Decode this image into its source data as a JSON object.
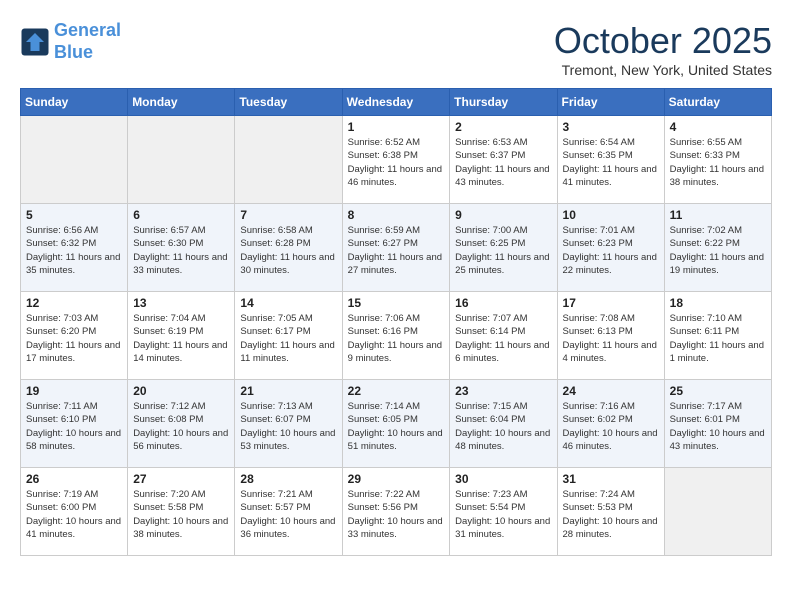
{
  "header": {
    "logo_line1": "General",
    "logo_line2": "Blue",
    "month_title": "October 2025",
    "location": "Tremont, New York, United States"
  },
  "days_of_week": [
    "Sunday",
    "Monday",
    "Tuesday",
    "Wednesday",
    "Thursday",
    "Friday",
    "Saturday"
  ],
  "weeks": [
    [
      {
        "day": "",
        "info": ""
      },
      {
        "day": "",
        "info": ""
      },
      {
        "day": "",
        "info": ""
      },
      {
        "day": "1",
        "info": "Sunrise: 6:52 AM\nSunset: 6:38 PM\nDaylight: 11 hours and 46 minutes."
      },
      {
        "day": "2",
        "info": "Sunrise: 6:53 AM\nSunset: 6:37 PM\nDaylight: 11 hours and 43 minutes."
      },
      {
        "day": "3",
        "info": "Sunrise: 6:54 AM\nSunset: 6:35 PM\nDaylight: 11 hours and 41 minutes."
      },
      {
        "day": "4",
        "info": "Sunrise: 6:55 AM\nSunset: 6:33 PM\nDaylight: 11 hours and 38 minutes."
      }
    ],
    [
      {
        "day": "5",
        "info": "Sunrise: 6:56 AM\nSunset: 6:32 PM\nDaylight: 11 hours and 35 minutes."
      },
      {
        "day": "6",
        "info": "Sunrise: 6:57 AM\nSunset: 6:30 PM\nDaylight: 11 hours and 33 minutes."
      },
      {
        "day": "7",
        "info": "Sunrise: 6:58 AM\nSunset: 6:28 PM\nDaylight: 11 hours and 30 minutes."
      },
      {
        "day": "8",
        "info": "Sunrise: 6:59 AM\nSunset: 6:27 PM\nDaylight: 11 hours and 27 minutes."
      },
      {
        "day": "9",
        "info": "Sunrise: 7:00 AM\nSunset: 6:25 PM\nDaylight: 11 hours and 25 minutes."
      },
      {
        "day": "10",
        "info": "Sunrise: 7:01 AM\nSunset: 6:23 PM\nDaylight: 11 hours and 22 minutes."
      },
      {
        "day": "11",
        "info": "Sunrise: 7:02 AM\nSunset: 6:22 PM\nDaylight: 11 hours and 19 minutes."
      }
    ],
    [
      {
        "day": "12",
        "info": "Sunrise: 7:03 AM\nSunset: 6:20 PM\nDaylight: 11 hours and 17 minutes."
      },
      {
        "day": "13",
        "info": "Sunrise: 7:04 AM\nSunset: 6:19 PM\nDaylight: 11 hours and 14 minutes."
      },
      {
        "day": "14",
        "info": "Sunrise: 7:05 AM\nSunset: 6:17 PM\nDaylight: 11 hours and 11 minutes."
      },
      {
        "day": "15",
        "info": "Sunrise: 7:06 AM\nSunset: 6:16 PM\nDaylight: 11 hours and 9 minutes."
      },
      {
        "day": "16",
        "info": "Sunrise: 7:07 AM\nSunset: 6:14 PM\nDaylight: 11 hours and 6 minutes."
      },
      {
        "day": "17",
        "info": "Sunrise: 7:08 AM\nSunset: 6:13 PM\nDaylight: 11 hours and 4 minutes."
      },
      {
        "day": "18",
        "info": "Sunrise: 7:10 AM\nSunset: 6:11 PM\nDaylight: 11 hours and 1 minute."
      }
    ],
    [
      {
        "day": "19",
        "info": "Sunrise: 7:11 AM\nSunset: 6:10 PM\nDaylight: 10 hours and 58 minutes."
      },
      {
        "day": "20",
        "info": "Sunrise: 7:12 AM\nSunset: 6:08 PM\nDaylight: 10 hours and 56 minutes."
      },
      {
        "day": "21",
        "info": "Sunrise: 7:13 AM\nSunset: 6:07 PM\nDaylight: 10 hours and 53 minutes."
      },
      {
        "day": "22",
        "info": "Sunrise: 7:14 AM\nSunset: 6:05 PM\nDaylight: 10 hours and 51 minutes."
      },
      {
        "day": "23",
        "info": "Sunrise: 7:15 AM\nSunset: 6:04 PM\nDaylight: 10 hours and 48 minutes."
      },
      {
        "day": "24",
        "info": "Sunrise: 7:16 AM\nSunset: 6:02 PM\nDaylight: 10 hours and 46 minutes."
      },
      {
        "day": "25",
        "info": "Sunrise: 7:17 AM\nSunset: 6:01 PM\nDaylight: 10 hours and 43 minutes."
      }
    ],
    [
      {
        "day": "26",
        "info": "Sunrise: 7:19 AM\nSunset: 6:00 PM\nDaylight: 10 hours and 41 minutes."
      },
      {
        "day": "27",
        "info": "Sunrise: 7:20 AM\nSunset: 5:58 PM\nDaylight: 10 hours and 38 minutes."
      },
      {
        "day": "28",
        "info": "Sunrise: 7:21 AM\nSunset: 5:57 PM\nDaylight: 10 hours and 36 minutes."
      },
      {
        "day": "29",
        "info": "Sunrise: 7:22 AM\nSunset: 5:56 PM\nDaylight: 10 hours and 33 minutes."
      },
      {
        "day": "30",
        "info": "Sunrise: 7:23 AM\nSunset: 5:54 PM\nDaylight: 10 hours and 31 minutes."
      },
      {
        "day": "31",
        "info": "Sunrise: 7:24 AM\nSunset: 5:53 PM\nDaylight: 10 hours and 28 minutes."
      },
      {
        "day": "",
        "info": ""
      }
    ]
  ]
}
